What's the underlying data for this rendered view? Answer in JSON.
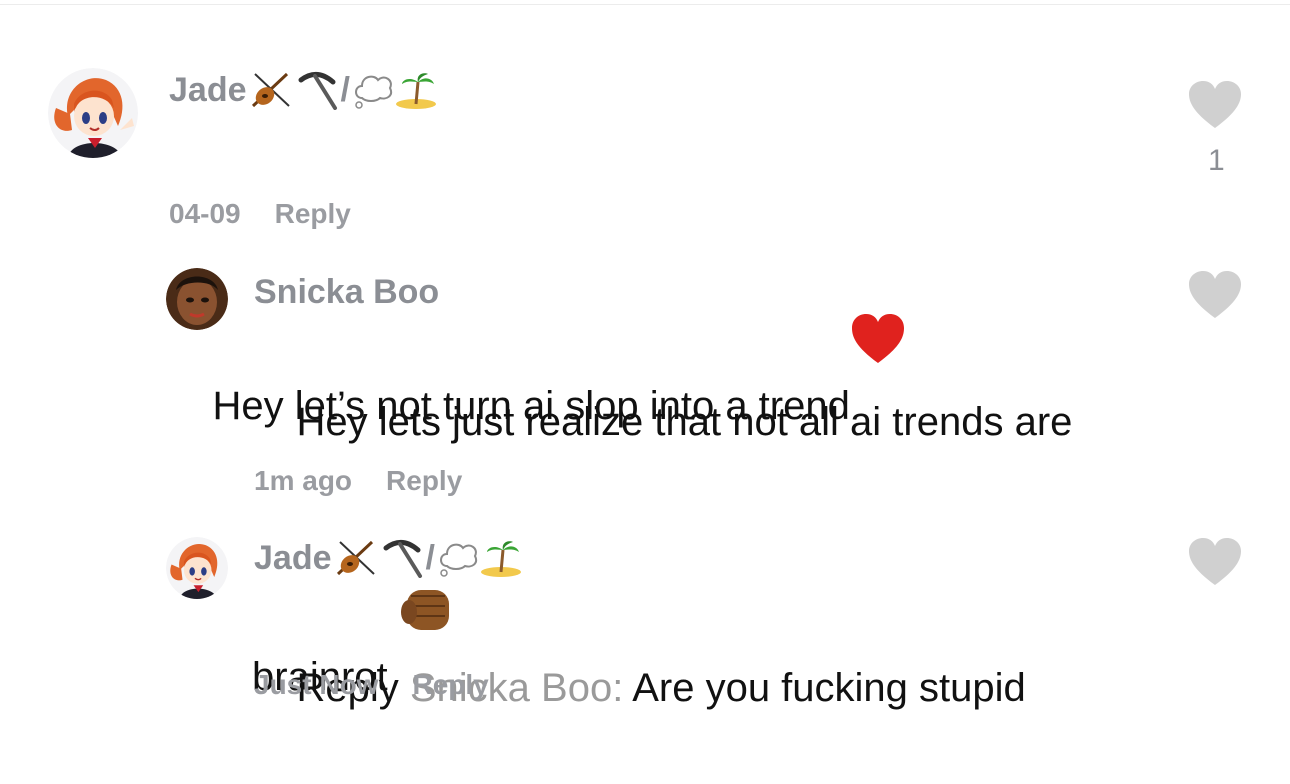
{
  "comments": [
    {
      "author": "Jade",
      "author_emojis": [
        "violin-icon",
        "pick-icon",
        "slash",
        "thought-bubble-icon",
        "island-icon"
      ],
      "slash_text": "/",
      "text": "Hey let’s not turn ai slop into a trend",
      "text_emoji": "heart-icon",
      "time": "04-09",
      "reply_label": "Reply",
      "likes": "1",
      "heart_color": "#d0d0d0",
      "replies": [
        {
          "author": "Snicka Boo",
          "text": "Hey lets just realize that not all ai trends are brainrot",
          "text_emoji": "fist-icon",
          "time": "1m ago",
          "reply_label": "Reply"
        },
        {
          "author": "Jade",
          "slash_text": "/",
          "reply_prefix": "Reply",
          "reply_to": "Snicka Boo:",
          "text": "Are you fucking stupid",
          "time": "Just Now",
          "reply_label": "Reply"
        }
      ]
    }
  ],
  "colors": {
    "name": "#8b8e94",
    "meta": "#9a9ca1",
    "text": "#111111",
    "heart": "#d0d0d0",
    "red_heart": "#e0221e"
  }
}
